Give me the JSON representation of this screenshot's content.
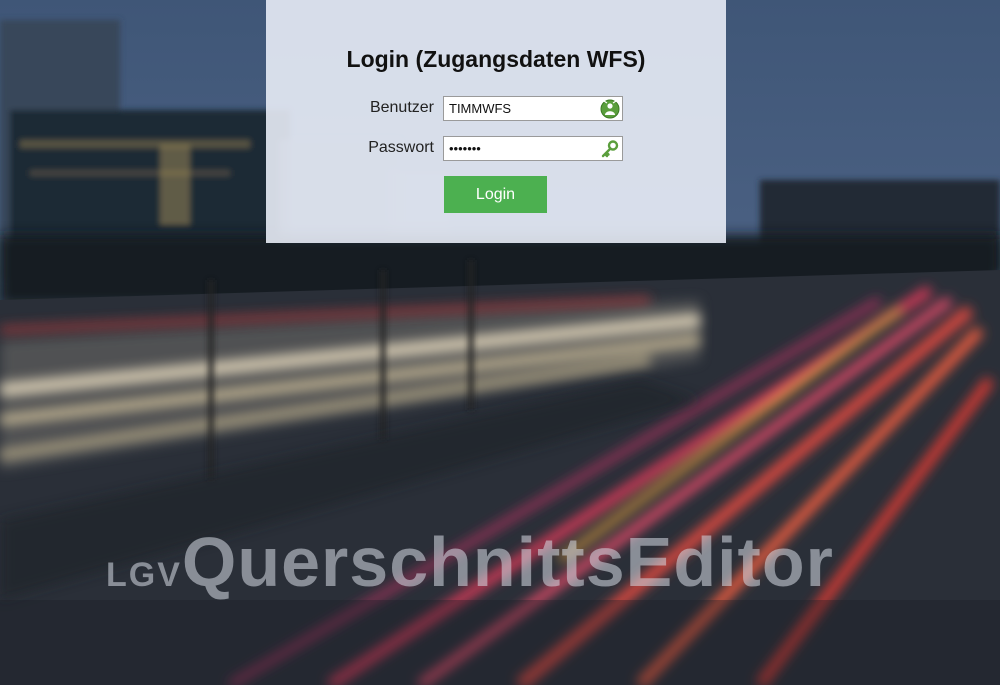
{
  "login": {
    "title": "Login (Zugangsdaten WFS)",
    "username_label": "Benutzer",
    "username_value": "TIMMWFS",
    "password_label": "Passwort",
    "password_value": "•••••••",
    "submit_label": "Login",
    "username_icon": "person-badge-icon",
    "password_icon": "key-icon"
  },
  "branding": {
    "prefix": "LGV",
    "name": "QuerschnittsEditor"
  },
  "colors": {
    "button_green": "#4cb050",
    "icon_green": "#5a9e3c"
  }
}
